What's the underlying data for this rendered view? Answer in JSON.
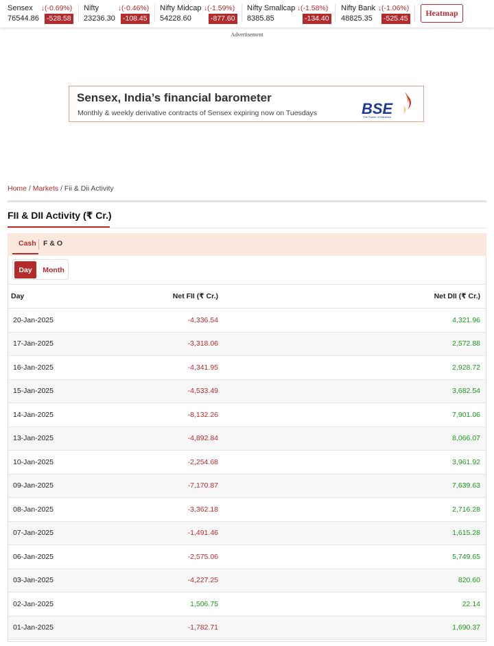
{
  "ticker": [
    {
      "name": "Sensex",
      "value": "76544.86",
      "pct": "(-0.69%)",
      "change": "-528.58"
    },
    {
      "name": "Nifty",
      "value": "23236.30",
      "pct": "(-0.46%)",
      "change": "-108.45"
    },
    {
      "name": "Nifty Midcap",
      "value": "54228.60",
      "pct": "(-1.59%)",
      "change": "-877.60"
    },
    {
      "name": "Nifty Smallcap",
      "value": "8385.85",
      "pct": "(-1.58%)",
      "change": "-134.40"
    },
    {
      "name": "Nifty Bank",
      "value": "48825.35",
      "pct": "(-1.06%)",
      "change": "-525.45"
    }
  ],
  "heatmap_label": "Heatmap",
  "ad_label": "Advertisement",
  "banner": {
    "title": "Sensex, India’s financial barometer",
    "subtitle": "Monthly & weekly derivative contracts of Sensex expiring now on Tuesdays",
    "logo_text": "BSE",
    "logo_tagline": "The Power of Valuence"
  },
  "breadcrumb": {
    "home": "Home",
    "markets": "Markets",
    "current": "Fii & Dii Activity",
    "sep": " / "
  },
  "page_title": "FII & DII Activity (₹ Cr.)",
  "tabs": {
    "cash": "Cash",
    "fo": "F & O"
  },
  "segment": {
    "day": "Day",
    "month": "Month"
  },
  "table": {
    "headers": [
      "Day",
      "Net FII (₹ Cr.)",
      "Net DII (₹ Cr.)"
    ],
    "rows": [
      {
        "day": "20-Jan-2025",
        "fii": "-4,336.54",
        "dii": "4,321.96"
      },
      {
        "day": "17-Jan-2025",
        "fii": "-3,318.06",
        "dii": "2,572.88"
      },
      {
        "day": "16-Jan-2025",
        "fii": "-4,341.95",
        "dii": "2,928.72"
      },
      {
        "day": "15-Jan-2025",
        "fii": "-4,533.49",
        "dii": "3,682.54"
      },
      {
        "day": "14-Jan-2025",
        "fii": "-8,132.26",
        "dii": "7,901.06"
      },
      {
        "day": "13-Jan-2025",
        "fii": "-4,892.84",
        "dii": "8,066.07"
      },
      {
        "day": "10-Jan-2025",
        "fii": "-2,254.68",
        "dii": "3,961.92"
      },
      {
        "day": "09-Jan-2025",
        "fii": "-7,170.87",
        "dii": "7,639.63"
      },
      {
        "day": "08-Jan-2025",
        "fii": "-3,362.18",
        "dii": "2,716.28"
      },
      {
        "day": "07-Jan-2025",
        "fii": "-1,491.46",
        "dii": "1,615.28"
      },
      {
        "day": "06-Jan-2025",
        "fii": "-2,575.06",
        "dii": "5,749.65"
      },
      {
        "day": "03-Jan-2025",
        "fii": "-4,227.25",
        "dii": "820.60"
      },
      {
        "day": "02-Jan-2025",
        "fii": "1,506.75",
        "dii": "22.14"
      },
      {
        "day": "01-Jan-2025",
        "fii": "-1,782.71",
        "dii": "1,690.37"
      }
    ]
  },
  "colors": {
    "accent": "#b52a2a",
    "negative": "#c0282d",
    "positive": "#1a9a1a",
    "tab_bar": "#fbe8dd"
  }
}
